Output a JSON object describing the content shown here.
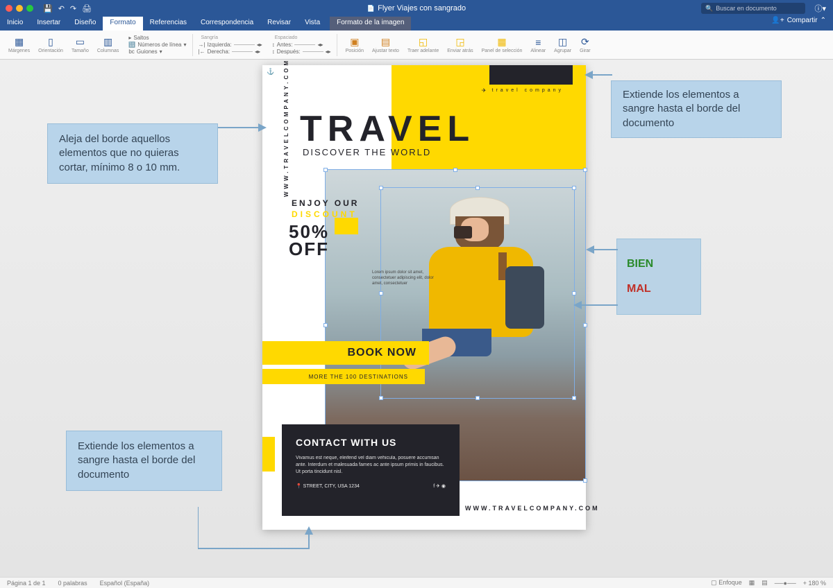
{
  "titlebar": {
    "doc_title": "Flyer Viajes con sangrado",
    "search_placeholder": "Buscar en documento"
  },
  "tabs": {
    "inicio": "Inicio",
    "insertar": "Insertar",
    "diseno": "Diseño",
    "formato": "Formato",
    "referencias": "Referencias",
    "correspondencia": "Correspondencia",
    "revisar": "Revisar",
    "vista": "Vista",
    "formato_imagen": "Formato de la imagen",
    "compartir": "Compartir"
  },
  "ribbon": {
    "margenes": "Márgenes",
    "orientacion": "Orientación",
    "tamano": "Tamaño",
    "columnas": "Columnas",
    "saltos": "Saltos",
    "n_linea": "Números de línea",
    "guiones": "Guiones",
    "sangria": "Sangría",
    "espaciado": "Espaciado",
    "izquierda": "Izquierda:",
    "derecha": "Derecha:",
    "antes": "Antes:",
    "despues": "Después:",
    "posicion": "Posición",
    "ajustar": "Ajustar texto",
    "traer_adelante": "Traer adelante",
    "enviar_atras": "Enviar atrás",
    "panel_sel": "Panel de selección",
    "alinear": "Alinear",
    "agrupar": "Agrupar",
    "girar": "Girar"
  },
  "flyer": {
    "vertical_url": "WWW.TRAVELCOMPANY.COM",
    "travel_company": "travel company",
    "headline": "TRAVEL",
    "subhead": "DISCOVER THE WORLD",
    "enjoy": "ENJOY OUR",
    "discount": "DISCOUNT",
    "fifty1": "50%",
    "fifty2": "OFF",
    "lorem": "Lorem ipsum dolor sit amet, consectetuer adipiscing elit, dolor amet, consectetuer",
    "book_now": "BOOK NOW",
    "destinations": "MORE THE 100 DESTINATIONS",
    "contact_title": "CONTACT WITH US",
    "contact_body": "Vivamus est neque, eleifend vel diam vehicula, posuere accumsan ante. Interdum et malesuada fames ac ante ipsum primis in faucibus. Ut porta tincidunt nisl.",
    "contact_addr": "STREET, CITY, USA 1234",
    "bottom_url": "WWW.TRAVELCOMPANY.COM"
  },
  "callouts": {
    "left_top": "Aleja del borde aquellos elementos que no quieras cortar, mínimo 8 o 10 mm.",
    "left_bottom": "Extiende los elementos a sangre hasta el borde del documento",
    "right_top": "Extiende los elementos a sangre hasta el borde del documento",
    "bien": "BIEN",
    "mal": "MAL"
  },
  "status": {
    "page": "Página 1 de 1",
    "words": "0 palabras",
    "lang": "Español (España)",
    "enfoque": "Enfoque",
    "zoom": "180 %"
  }
}
